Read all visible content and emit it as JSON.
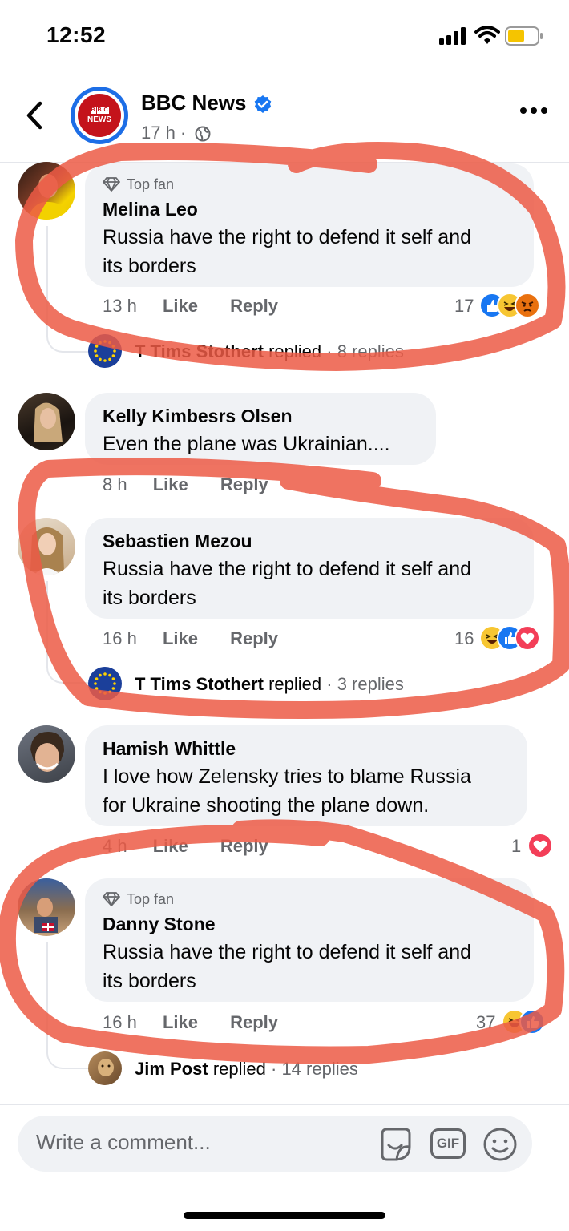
{
  "status_bar": {
    "time": "12:52"
  },
  "header": {
    "back_icon": "chevron-left-icon",
    "page_name": "BBC News",
    "avatar_text": "NEWS",
    "verified_icon": "verified-badge-icon",
    "post_time": "17 h ·",
    "audience_icon": "globe-icon",
    "more_icon": "more-horizontal-icon"
  },
  "comments": [
    {
      "top_fan": "Top fan",
      "author": "Melina Leo",
      "text_lines": [
        "Russia have the right to defend it self and",
        "its borders"
      ],
      "age": "13 h",
      "like": "Like",
      "reply": "Reply",
      "reaction_count": "17",
      "reactions": [
        "like",
        "haha",
        "angry"
      ],
      "reply_summary": {
        "author": "T Tims Stothert",
        "verb": "replied",
        "count": "· 8 replies"
      }
    },
    {
      "top_fan": "",
      "author": "Kelly Kimbesrs Olsen",
      "text_lines": [
        "Even the plane was Ukrainian...."
      ],
      "age": "8 h",
      "like": "Like",
      "reply": "Reply"
    },
    {
      "top_fan": "",
      "author": "Sebastien Mezou",
      "text_lines": [
        "Russia have the right to defend it self and",
        "its borders"
      ],
      "age": "16 h",
      "like": "Like",
      "reply": "Reply",
      "reaction_count": "16",
      "reactions": [
        "haha",
        "like",
        "love"
      ],
      "reply_summary": {
        "author": "T Tims Stothert",
        "verb": "replied",
        "count": "· 3 replies"
      }
    },
    {
      "top_fan": "",
      "author": "Hamish Whittle",
      "text_lines": [
        "I love how Zelensky tries to blame Russia",
        "for Ukraine shooting the plane down."
      ],
      "age": "4 h",
      "like": "Like",
      "reply": "Reply",
      "reaction_count": "1",
      "reactions": [
        "love"
      ]
    },
    {
      "top_fan": "Top fan",
      "author": "Danny Stone",
      "text_lines": [
        "Russia have the right to defend it self and",
        "its borders"
      ],
      "age": "16 h",
      "like": "Like",
      "reply": "Reply",
      "reaction_count": "37",
      "reactions": [
        "haha",
        "like"
      ],
      "reply_summary": {
        "author": "Jim Post",
        "verb": "replied",
        "count": "· 14 replies"
      }
    }
  ],
  "composer": {
    "placeholder": "Write a comment...",
    "sticker_icon": "sticker-icon",
    "gif_label": "GIF",
    "emoji_icon": "emoji-icon"
  },
  "colors": {
    "accent_blue": "#1877f2",
    "bubble_gray": "#f0f2f5",
    "meta_gray": "#65676b",
    "highlight_red": "#ec5a45"
  }
}
